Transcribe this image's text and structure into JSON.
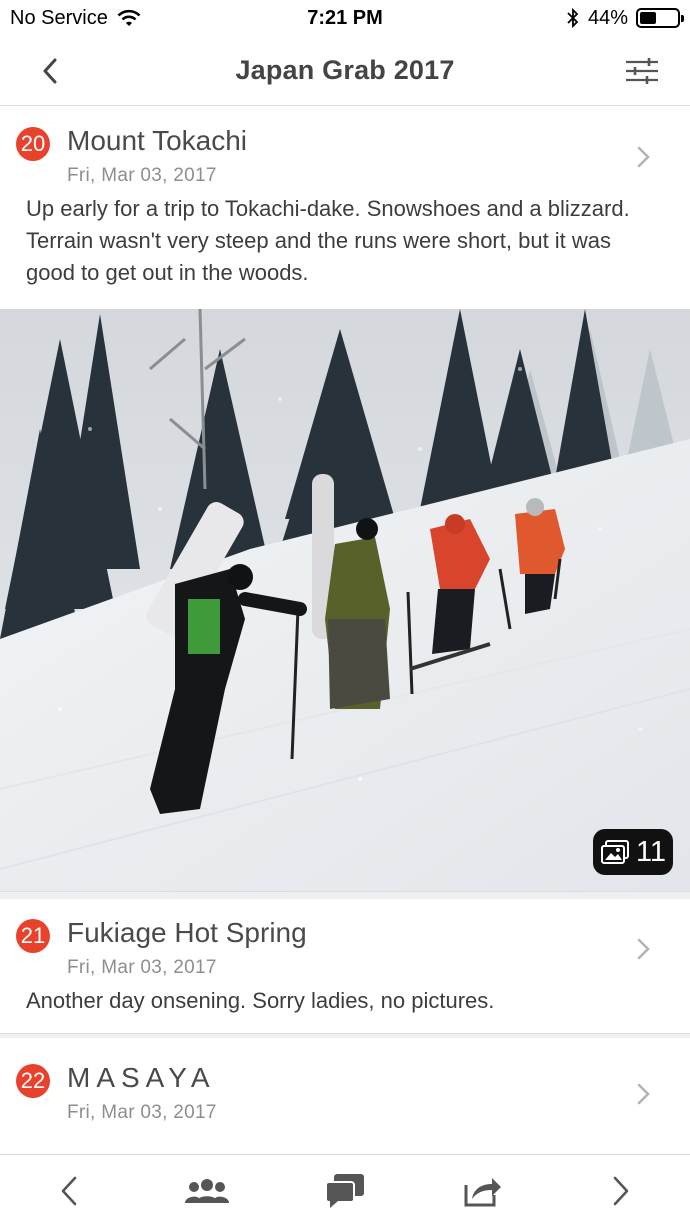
{
  "status": {
    "carrier": "No Service",
    "time": "7:21 PM",
    "battery": "44%",
    "battery_level": 0.44
  },
  "nav": {
    "title": "Japan Grab 2017",
    "back_icon": "chevron-left-icon",
    "filter_icon": "sliders-icon"
  },
  "entries": [
    {
      "number": "20",
      "title": "Mount Tokachi",
      "date": "Fri, Mar 03, 2017",
      "description": "Up early for a trip to Tokachi-dake. Snowshoes and a blizzard. Terrain wasn't very steep and the runs were short, but it was good to get out in the woods.",
      "photo_count": "11"
    },
    {
      "number": "21",
      "title": "Fukiage Hot Spring",
      "date": "Fri, Mar 03, 2017",
      "description": "Another day onsening. Sorry ladies, no pictures."
    },
    {
      "number": "22",
      "title": "MASAYA",
      "date": "Fri, Mar 03, 2017"
    }
  ],
  "tabbar": {
    "items": [
      "chevron-left-icon",
      "people-icon",
      "chat-icon",
      "share-icon",
      "chevron-right-icon"
    ]
  },
  "colors": {
    "badge": "#e8412c",
    "title": "#4a4a4a",
    "date": "#8e8e8e",
    "icon": "#555555"
  }
}
